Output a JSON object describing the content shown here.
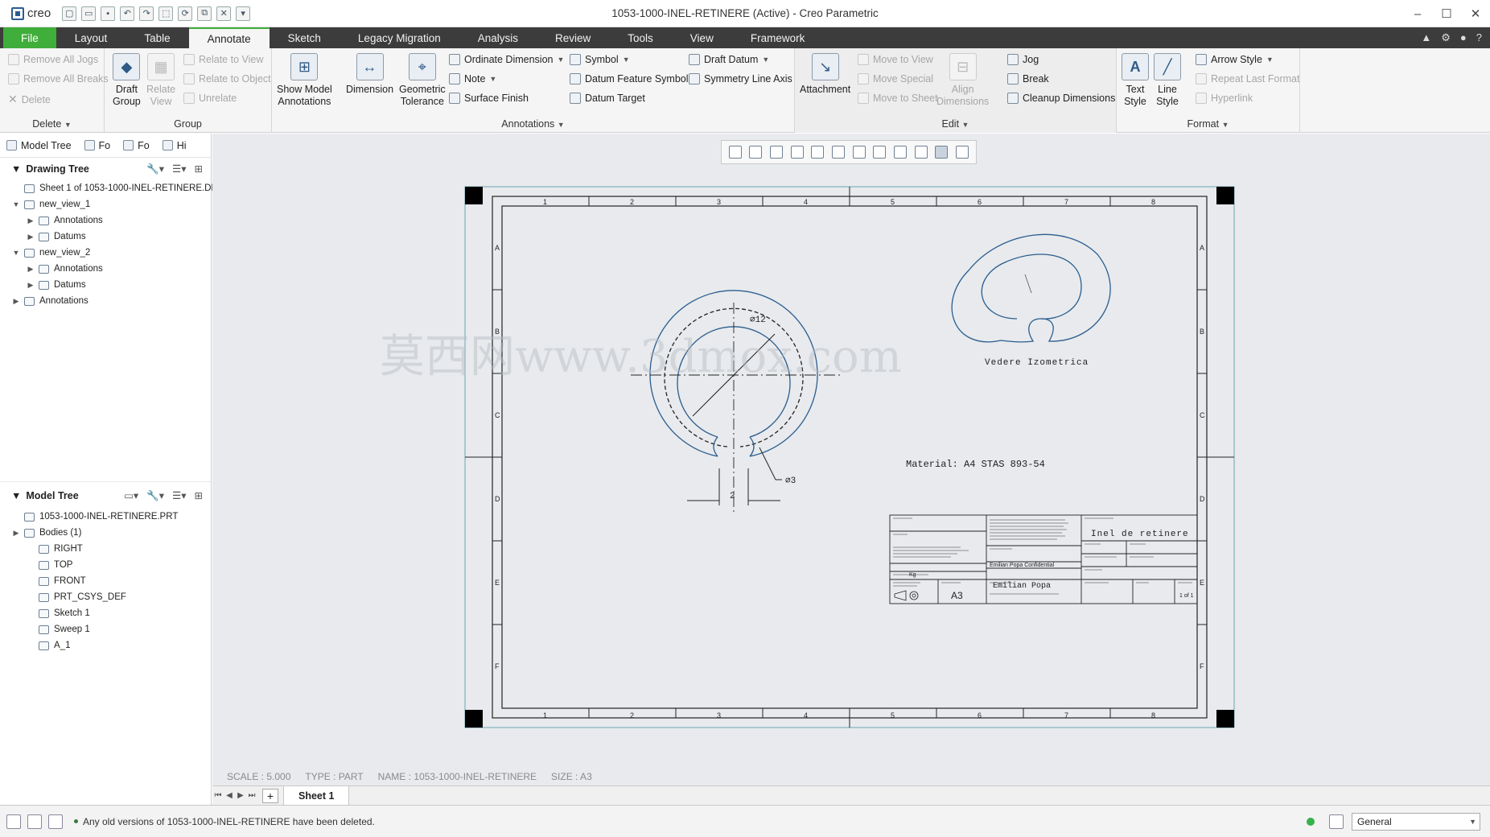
{
  "app": {
    "logo": "creo",
    "title": "1053-1000-INEL-RETINERE (Active) - Creo Parametric"
  },
  "qat_icons": [
    "new-icon",
    "open-icon",
    "save-icon",
    "undo-icon",
    "redo-icon",
    "select-box-icon",
    "regenerate-icon",
    "windows-icon",
    "close-window-icon",
    "customize-icon"
  ],
  "menu": {
    "tabs": [
      "File",
      "Layout",
      "Table",
      "Annotate",
      "Sketch",
      "Legacy Migration",
      "Analysis",
      "Review",
      "Tools",
      "View",
      "Framework"
    ],
    "active": "Annotate"
  },
  "ribbon": {
    "delete_group": {
      "label": "Delete",
      "remove_jogs": "Remove All Jogs",
      "remove_breaks": "Remove All Breaks",
      "delete": "Delete"
    },
    "group_group": {
      "label": "Group",
      "draft_group_1": "Draft",
      "draft_group_2": "Group",
      "relate_view_1": "Relate",
      "relate_view_2": "View",
      "relate_to_view": "Relate to View",
      "relate_to_object": "Relate to Object",
      "unrelate": "Unrelate"
    },
    "annotations_group": {
      "label": "Annotations",
      "show_model_1": "Show Model",
      "show_model_2": "Annotations",
      "dimension": "Dimension",
      "geom_tol_1": "Geometric",
      "geom_tol_2": "Tolerance",
      "ordinate": "Ordinate Dimension",
      "note": "Note",
      "surface_finish": "Surface Finish",
      "symbol": "Symbol",
      "datum_feature_symbol": "Datum Feature Symbol",
      "datum_target": "Datum Target",
      "draft_datum": "Draft Datum",
      "symmetry_line_axis": "Symmetry Line Axis"
    },
    "edit_group": {
      "label": "Edit",
      "attachment": "Attachment",
      "move_to_view": "Move to View",
      "move_special": "Move Special",
      "move_to_sheet": "Move to Sheet",
      "align_1": "Align",
      "align_2": "Dimensions",
      "jog": "Jog",
      "break": "Break",
      "cleanup": "Cleanup Dimensions"
    },
    "format_group": {
      "label": "Format",
      "text_style_1": "Text",
      "text_style_2": "Style",
      "line_style_1": "Line",
      "line_style_2": "Style",
      "arrow_style": "Arrow Style",
      "repeat_last": "Repeat Last Format",
      "hyperlink": "Hyperlink"
    }
  },
  "panel_tabs": [
    "Model Tree",
    "Fo",
    "Fo",
    "Hi"
  ],
  "drawing_tree": {
    "header": "Drawing Tree",
    "items": [
      {
        "label": "Sheet 1 of 1053-1000-INEL-RETINERE.DRW",
        "level": 0,
        "expander": ""
      },
      {
        "label": "new_view_1",
        "level": 0,
        "expander": "▼"
      },
      {
        "label": "Annotations",
        "level": 1,
        "expander": "▶"
      },
      {
        "label": "Datums",
        "level": 1,
        "expander": "▶"
      },
      {
        "label": "new_view_2",
        "level": 0,
        "expander": "▼"
      },
      {
        "label": "Annotations",
        "level": 1,
        "expander": "▶"
      },
      {
        "label": "Datums",
        "level": 1,
        "expander": "▶"
      },
      {
        "label": "Annotations",
        "level": 0,
        "expander": "▶"
      }
    ]
  },
  "model_tree": {
    "header": "Model Tree",
    "items": [
      {
        "label": "1053-1000-INEL-RETINERE.PRT",
        "level": 0,
        "expander": ""
      },
      {
        "label": "Bodies (1)",
        "level": 0,
        "expander": "▶"
      },
      {
        "label": "RIGHT",
        "level": 1,
        "expander": ""
      },
      {
        "label": "TOP",
        "level": 1,
        "expander": ""
      },
      {
        "label": "FRONT",
        "level": 1,
        "expander": ""
      },
      {
        "label": "PRT_CSYS_DEF",
        "level": 1,
        "expander": ""
      },
      {
        "label": "Sketch 1",
        "level": 1,
        "expander": ""
      },
      {
        "label": "Sweep 1",
        "level": 1,
        "expander": ""
      },
      {
        "label": "A_1",
        "level": 1,
        "expander": ""
      }
    ]
  },
  "drawing": {
    "border_numbers": [
      "1",
      "2",
      "3",
      "4",
      "5",
      "6",
      "7",
      "8"
    ],
    "border_letters": [
      "A",
      "B",
      "C",
      "D",
      "E",
      "F"
    ],
    "dim_diameter": "⌀12",
    "dim_small": "⌀3",
    "dim_gap": "2",
    "iso_label": "Vedere Izometrica",
    "material_note": "Material: A4 STAS 893-54",
    "watermark": "莫西网www.3dmox.com",
    "title_block": {
      "part_name": "Inel de retinere",
      "author": "Emilian Popa",
      "author_note": "Emilian Popa Confidential",
      "size": "A3",
      "mass": "Kg",
      "sheet": "1 of 1"
    }
  },
  "sheet_status": {
    "scale": "SCALE : 5.000",
    "type": "TYPE : PART",
    "name": "NAME : 1053-1000-INEL-RETINERE",
    "size": "SIZE : A3"
  },
  "sheet_tabs": {
    "active": "Sheet 1"
  },
  "status": {
    "message": "Any old versions of 1053-1000-INEL-RETINERE have been deleted.",
    "filter": "General"
  }
}
